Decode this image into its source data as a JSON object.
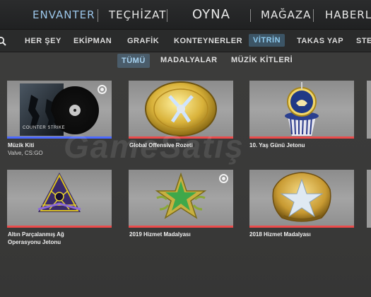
{
  "topnav": {
    "items": [
      {
        "label": "ENVANTER",
        "active": true
      },
      {
        "label": "TEÇHİZAT",
        "active": false
      },
      {
        "label": "OYNA",
        "active": false
      },
      {
        "label": "MAĞAZA",
        "active": false
      },
      {
        "label": "HABERLE",
        "active": false
      }
    ]
  },
  "subnav": {
    "search_icon": "search-icon",
    "items": [
      {
        "label": "HER ŞEY",
        "active": false
      },
      {
        "label": "EKİPMAN",
        "active": false
      },
      {
        "label": "GRAFİK",
        "active": false
      },
      {
        "label": "KONTEYNERLER",
        "active": false
      },
      {
        "label": "VİTRİN",
        "active": true
      },
      {
        "label": "TAKAS YAP",
        "active": false
      },
      {
        "label": "STE",
        "active": false
      }
    ]
  },
  "filters": [
    {
      "label": "TÜMÜ",
      "active": true
    },
    {
      "label": "MADALYALAR",
      "active": false
    },
    {
      "label": "MÜZİK KİTLERİ",
      "active": false
    }
  ],
  "items": [
    {
      "name": "Müzik Kiti",
      "subtitle": "Valve, CS:GO",
      "rarity_color": "#4b69ff",
      "equipped": true,
      "art_text": "COUNTER STRIKE"
    },
    {
      "name": "Global Offensive Rozeti",
      "subtitle": "",
      "rarity_color": "#eb4b4b",
      "equipped": false
    },
    {
      "name": "10. Yaş Günü Jetonu",
      "subtitle": "",
      "rarity_color": "#eb4b4b",
      "equipped": false
    },
    {
      "name": "Altın Parçalanmış Ağ\nOperasyonu Jetonu",
      "name_line1": "Altın Parçalanmış Ağ",
      "name_line2": "Operasyonu Jetonu",
      "subtitle": "",
      "rarity_color": "#eb4b4b",
      "equipped": false
    },
    {
      "name": "2019 Hizmet Madalyası",
      "subtitle": "",
      "rarity_color": "#eb4b4b",
      "equipped": true
    },
    {
      "name": "2018 Hizmet Madalyası",
      "subtitle": "",
      "rarity_color": "#eb4b4b",
      "equipped": false
    }
  ],
  "watermark": "GameSatış",
  "colors": {
    "accent": "#9cc6ea",
    "rarity_blue": "#4b69ff",
    "rarity_red": "#eb4b4b"
  }
}
